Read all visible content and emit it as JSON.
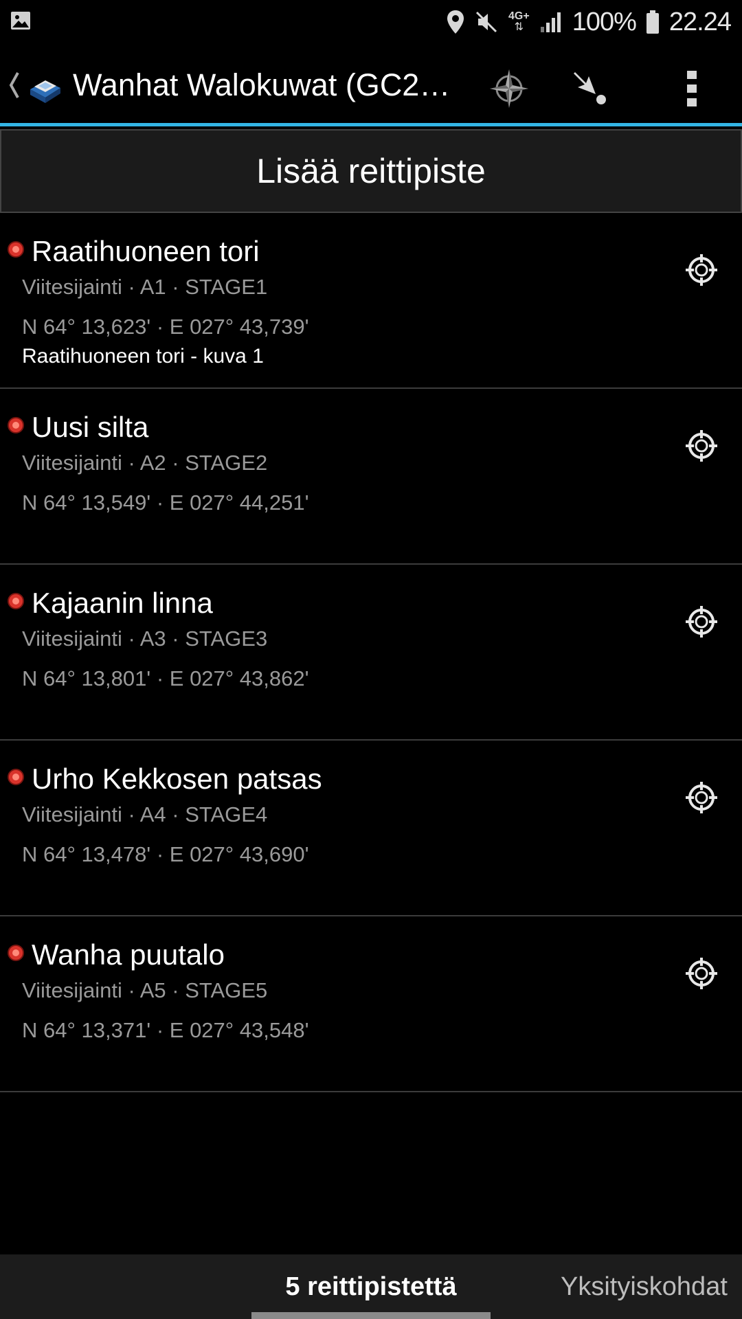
{
  "status_bar": {
    "battery": "100%",
    "time": "22.24",
    "network": "4G+",
    "icons": [
      "gallery-icon",
      "location-icon",
      "mute-icon",
      "network-icon",
      "signal-icon",
      "battery-icon"
    ]
  },
  "action_bar": {
    "title": "Wanhat Walokuwat (GC2…",
    "icons": [
      "up-icon",
      "app-icon",
      "compass-icon",
      "navigate-icon",
      "overflow-menu-icon"
    ]
  },
  "add_waypoint_label": "Lisää reittipiste",
  "waypoints": [
    {
      "name": "Raatihuoneen tori",
      "meta": "Viitesijainti · A1 · STAGE1",
      "coords": "N 64° 13,623' · E 027° 43,739'",
      "note": "Raatihuoneen tori - kuva 1"
    },
    {
      "name": "Uusi silta",
      "meta": "Viitesijainti · A2 · STAGE2",
      "coords": "N 64° 13,549' · E 027° 44,251'",
      "note": ""
    },
    {
      "name": "Kajaanin linna",
      "meta": "Viitesijainti · A3 · STAGE3",
      "coords": "N 64° 13,801' · E 027° 43,862'",
      "note": ""
    },
    {
      "name": "Urho Kekkosen patsas",
      "meta": "Viitesijainti · A4 · STAGE4",
      "coords": "N 64° 13,478' · E 027° 43,690'",
      "note": ""
    },
    {
      "name": "Wanha puutalo",
      "meta": "Viitesijainti · A5 · STAGE5",
      "coords": "N 64° 13,371' · E 027° 43,548'",
      "note": ""
    }
  ],
  "tabs": {
    "active": "5 reittipistettä",
    "next": "Yksityiskohdat"
  },
  "colors": {
    "accent": "#33b5e5",
    "waypoint_marker": "#d9332b",
    "background": "#000000"
  }
}
